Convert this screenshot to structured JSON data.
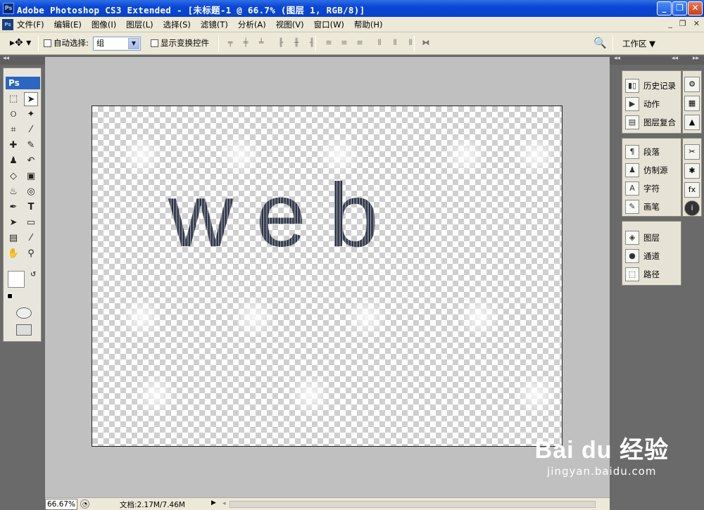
{
  "window": {
    "title": "Adobe Photoshop CS3 Extended - [未标题-1 @ 66.7% (图层 1, RGB/8)]",
    "app_badge": "Ps",
    "controls": [
      "_",
      "❐",
      "✕"
    ]
  },
  "menubar": {
    "items": [
      "文件(F)",
      "编辑(E)",
      "图像(I)",
      "图层(L)",
      "选择(S)",
      "滤镜(T)",
      "分析(A)",
      "视图(V)",
      "窗口(W)",
      "帮助(H)"
    ],
    "doc_controls": [
      "_",
      "❐",
      "✕"
    ]
  },
  "options": {
    "auto_select_label": "自动选择:",
    "auto_select_value": "组",
    "show_transform_label": "显示变换控件",
    "workspace_label": "工作区 ▼"
  },
  "toolbox": {
    "logo": "Ps"
  },
  "canvas": {
    "text": "web"
  },
  "panels": {
    "group1": [
      "历史记录",
      "动作",
      "图层复合"
    ],
    "group2": [
      "段落",
      "仿制源",
      "字符",
      "画笔"
    ],
    "group3": [
      "图层",
      "通道",
      "路径"
    ]
  },
  "statusbar": {
    "zoom": "66.67%",
    "doc_info": "文档:2.17M/7.46M"
  },
  "watermark": {
    "brand": "Bai du 经验",
    "url": "jingyan.baidu.com"
  }
}
